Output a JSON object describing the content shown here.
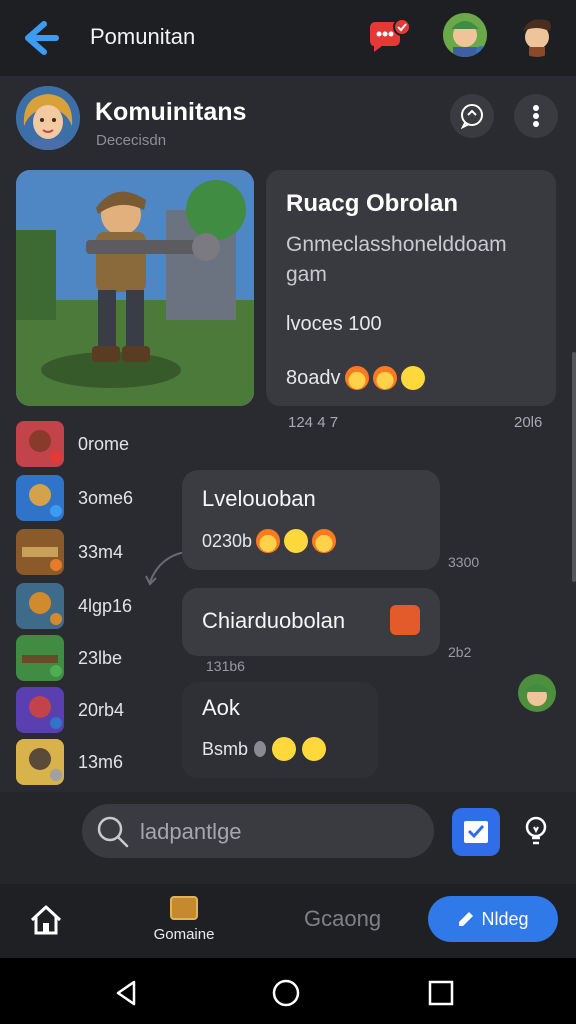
{
  "topbar": {
    "title": "Pomunitan",
    "back_icon": "back-arrow-icon",
    "chat_badge_icon": "chat-bubble-icon"
  },
  "community": {
    "name": "Komuinitans",
    "subtitle": "Dececisdn"
  },
  "featured": {
    "title": "Ruacg Obrolan",
    "description": "Gnmeclasshonelddoam gam",
    "stat": "lvoces 100",
    "reactions_label": "8oadv",
    "time_left": "124 4 7",
    "time_right": "20l6"
  },
  "members": [
    {
      "label": "0rome",
      "color": "#c2434a"
    },
    {
      "label": "3ome6",
      "color": "#2f74c8"
    },
    {
      "label": "33m4",
      "color": "#8a5a2b"
    },
    {
      "label": "4lgp16",
      "color": "#d28a2e"
    },
    {
      "label": "23lbe",
      "color": "#3f8c42"
    },
    {
      "label": "20rb4",
      "color": "#5a3fb0"
    },
    {
      "label": "13m6",
      "color": "#d8b24a"
    }
  ],
  "messages": [
    {
      "text": "Lvelouoban",
      "reactions": "0230b",
      "time": "3300"
    },
    {
      "text": "Chiarduobolan",
      "time_left": "131b6",
      "time_right": "2b2"
    },
    {
      "text": "Aok",
      "reactions": "Bsmb"
    }
  ],
  "composer": {
    "placeholder": "ladpantlge"
  },
  "bottomnav": {
    "game_label": "Gomaine",
    "middle_label": "Gcaong",
    "pill_label": "Nldeg"
  },
  "colors": {
    "accent": "#2f7ae8",
    "background": "#2a2b30",
    "notification": "#e53935"
  }
}
